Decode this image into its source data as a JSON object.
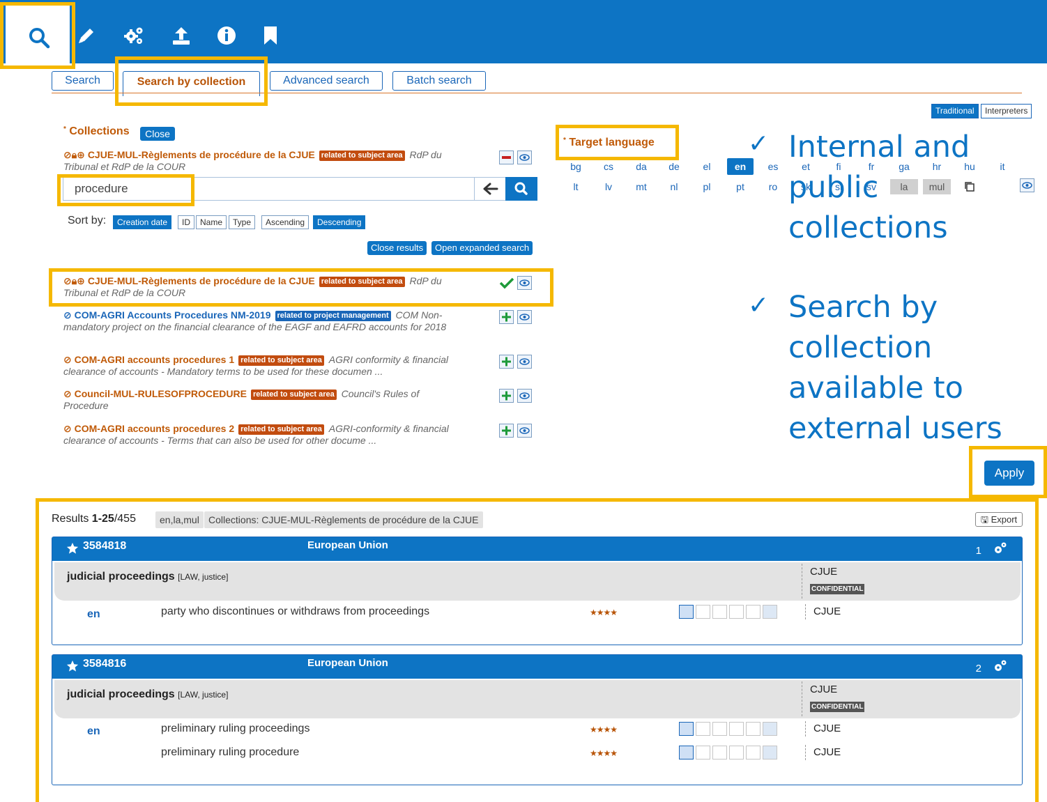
{
  "tabs": {
    "search": "Search",
    "by_collection": "Search by collection",
    "advanced": "Advanced search",
    "batch": "Batch search"
  },
  "mode": {
    "traditional": "Traditional",
    "interpreters": "Interpreters"
  },
  "collections": {
    "label": "Collections",
    "required_mark": "*",
    "close": "Close",
    "selected": {
      "title": "CJUE-MUL-Règlements de procédure de la CJUE",
      "badge": "related to subject area",
      "desc": "RdP du Tribunal et RdP de la COUR"
    },
    "search_value": "procedure",
    "sort_label": "Sort by:",
    "sort": [
      "Creation date",
      "ID",
      "Name",
      "Type"
    ],
    "order": [
      "Ascending",
      "Descending"
    ],
    "close_results": "Close results",
    "open_expanded": "Open expanded search",
    "results": [
      {
        "title": "CJUE-MUL-Règlements de procédure de la CJUE",
        "badge": "related to subject area",
        "desc": "RdP du Tribunal et RdP de la COUR"
      },
      {
        "title": "COM-AGRI Accounts Procedures NM-2019",
        "badge": "related to project management",
        "desc": "COM Non-mandatory project on the financial clearance of the EAGF and EAFRD accounts for 2018"
      },
      {
        "title": "COM-AGRI accounts procedures 1",
        "badge": "related to subject area",
        "desc": "AGRI conformity & financial clearance of accounts - Mandatory terms to be used for these documen ..."
      },
      {
        "title": "Council-MUL-RULESOFPROCEDURE",
        "badge": "related to subject area",
        "desc": "Council's Rules of Procedure"
      },
      {
        "title": "COM-AGRI accounts procedures 2",
        "badge": "related to subject area",
        "desc": "AGRI-conformity & financial clearance of accounts - Terms that can also be used for other docume ..."
      }
    ]
  },
  "target_language": {
    "label": "Target language",
    "required_mark": "*",
    "row1": [
      "bg",
      "cs",
      "da",
      "de",
      "el",
      "en",
      "es",
      "et",
      "fi",
      "fr",
      "ga",
      "hr",
      "hu",
      "it"
    ],
    "row2": [
      "lt",
      "lv",
      "mt",
      "nl",
      "pl",
      "pt",
      "ro",
      "sk",
      "sl",
      "sv",
      "la",
      "mul"
    ],
    "selected": [
      "en",
      "la",
      "mul"
    ]
  },
  "notes": {
    "check": "✓",
    "note1": [
      "Internal and",
      "public",
      "collections"
    ],
    "note2": [
      "Search by",
      "collection",
      "available to",
      "external users"
    ]
  },
  "apply": "Apply",
  "results": {
    "prefix": "Results ",
    "range": "1-25",
    "total": "/455",
    "lang_chip": "en,la,mul",
    "coll_chip": "Collections: CJUE-MUL-Règlements de procédure de la CJUE",
    "export": "Export",
    "cards": [
      {
        "id": "3584818",
        "region": "European Union",
        "num": "1",
        "domain": "judicial proceedings",
        "domain_sub": "[LAW, justice]",
        "org": "CJUE",
        "conf": "CONFIDENTIAL",
        "lang": "en",
        "terms": [
          {
            "text": "party who discontinues or withdraws from proceedings",
            "stars": "★★★★",
            "org": "CJUE"
          }
        ]
      },
      {
        "id": "3584816",
        "region": "European Union",
        "num": "2",
        "domain": "judicial proceedings",
        "domain_sub": "[LAW, justice]",
        "org": "CJUE",
        "conf": "CONFIDENTIAL",
        "lang": "en",
        "terms": [
          {
            "text": "preliminary ruling proceedings",
            "stars": "★★★★",
            "org": "CJUE"
          },
          {
            "text": "preliminary ruling procedure",
            "stars": "★★★★",
            "org": "CJUE"
          }
        ]
      }
    ]
  }
}
